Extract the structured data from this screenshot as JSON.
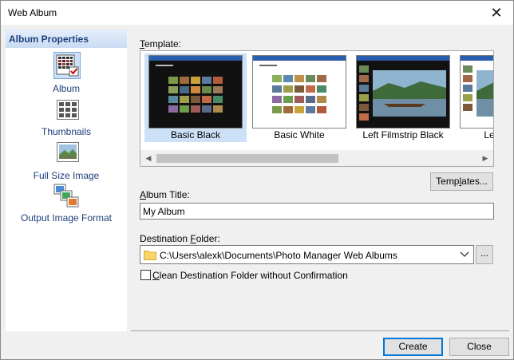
{
  "window": {
    "title": "Web Album",
    "close_glyph": "✕"
  },
  "sidebar": {
    "header": "Album Properties",
    "items": [
      {
        "label": "Album",
        "icon": "album-icon"
      },
      {
        "label": "Thumbnails",
        "icon": "thumbnails-icon"
      },
      {
        "label": "Full Size Image",
        "icon": "full-size-image-icon"
      },
      {
        "label": "Output Image Format",
        "icon": "output-format-icon"
      }
    ]
  },
  "template": {
    "label_prefix": "",
    "label_mnemonic": "T",
    "label_rest": "emplate:",
    "items": [
      {
        "caption": "Basic Black",
        "selected": true
      },
      {
        "caption": "Basic White",
        "selected": false
      },
      {
        "caption": "Left Filmstrip Black",
        "selected": false
      },
      {
        "caption": "Left Fi",
        "selected": false
      }
    ],
    "scroll_left": "◀",
    "scroll_right": "▶"
  },
  "templates_button": {
    "prefix": "Temp",
    "mnemonic": "l",
    "rest": "ates..."
  },
  "album_title": {
    "label_mnemonic": "A",
    "label_rest": "lbum Title:",
    "value": "My Album"
  },
  "destination": {
    "label_prefix": "Destination ",
    "label_mnemonic": "F",
    "label_rest": "older:",
    "value": "C:\\Users\\alexk\\Documents\\Photo Manager Web Albums",
    "browse_label": "..."
  },
  "clean_option": {
    "label_mnemonic": "C",
    "label_rest": "lean Destination Folder without Confirmation",
    "checked": false
  },
  "footer": {
    "create_label": "Create",
    "close_label": "Close"
  }
}
